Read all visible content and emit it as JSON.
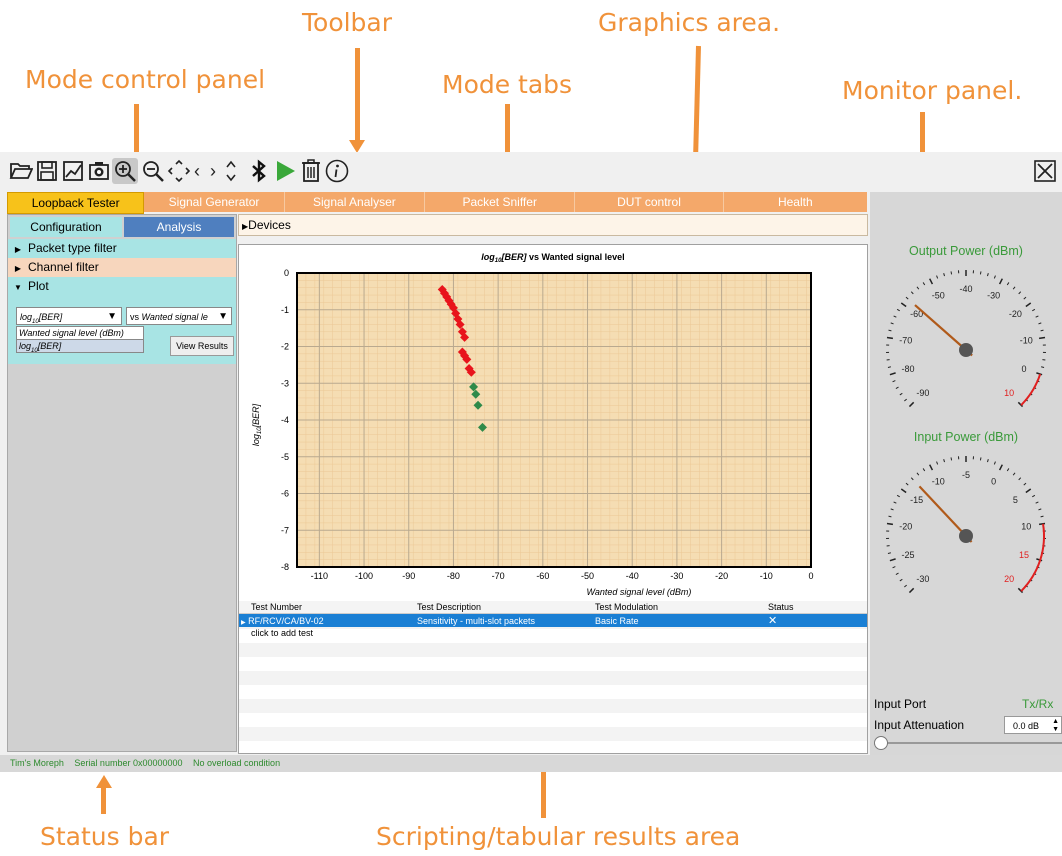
{
  "callouts": {
    "toolbar": "Toolbar",
    "graphics_area": "Graphics area.",
    "mode_control_panel": "Mode control panel",
    "mode_tabs": "Mode tabs",
    "monitor_panel": "Monitor panel.",
    "status_bar": "Status bar",
    "scripting_area": "Scripting/tabular results area"
  },
  "toolbar": {
    "icons": [
      "open-folder-icon",
      "save-icon",
      "chart-icon",
      "camera-icon",
      "zoom-in-icon",
      "zoom-out-icon",
      "pan-icon",
      "scroll-left-icon",
      "scroll-right-icon",
      "scroll-vertical-icon",
      "bluetooth-icon",
      "play-icon",
      "trash-icon",
      "info-icon",
      "close-window-icon"
    ]
  },
  "mode_tabs": [
    "Loopback Tester",
    "Signal Generator",
    "Signal Analyser",
    "Packet Sniffer",
    "DUT control",
    "Health"
  ],
  "active_mode_tab": "Loopback Tester",
  "control_panel": {
    "tabs": [
      "Configuration",
      "Analysis"
    ],
    "active_tab": "Analysis",
    "tree": [
      {
        "label": "Packet type filter",
        "expanded": false
      },
      {
        "label": "Channel filter",
        "expanded": false
      },
      {
        "label": "Plot",
        "expanded": true
      }
    ],
    "plot": {
      "y_select_label": "log",
      "y_select_sub": "10",
      "y_select_suffix": "[BER]",
      "x_select_prefix": "vs ",
      "x_select_value": "Wanted signal le",
      "dropdown_options": [
        "Wanted signal level (dBm)",
        "log10[BER]"
      ],
      "option_log": "log",
      "option_sub": "10",
      "option_suffix": "[BER]",
      "view_results_label": "View Results"
    }
  },
  "graphics": {
    "devices_label": "Devices",
    "results_table": {
      "columns": [
        "Test Number",
        "Test Description",
        "Test Modulation",
        "Status"
      ],
      "rows": [
        {
          "number": "RF/RCV/CA/BV-02",
          "description": "Sensitivity - multi-slot packets",
          "modulation": "Basic Rate",
          "status": "✕"
        }
      ],
      "add_row_label": "click to add test"
    }
  },
  "chart_data": {
    "type": "scatter",
    "title_prefix": "log",
    "title_sub": "10",
    "title_suffix": "[BER]",
    "title_rest": " vs Wanted signal level",
    "xlabel": "Wanted signal level (dBm)",
    "ylabel_prefix": "log",
    "ylabel_sub": "10",
    "ylabel_suffix": "[BER]",
    "xlim": [
      -115,
      0
    ],
    "ylim": [
      -8,
      0
    ],
    "x_ticks": [
      -110,
      -100,
      -90,
      -80,
      -70,
      -60,
      -50,
      -40,
      -30,
      -20,
      -10,
      0
    ],
    "y_ticks": [
      0,
      -1,
      -2,
      -3,
      -4,
      -5,
      -6,
      -7,
      -8
    ],
    "grid": true,
    "series": [
      {
        "color": "#e8141c",
        "points": [
          [
            -82.5,
            -0.45
          ],
          [
            -82,
            -0.55
          ],
          [
            -81.5,
            -0.65
          ],
          [
            -81,
            -0.75
          ],
          [
            -80.5,
            -0.85
          ],
          [
            -80,
            -0.95
          ],
          [
            -79.5,
            -1.1
          ],
          [
            -79,
            -1.25
          ],
          [
            -78.5,
            -1.4
          ],
          [
            -78,
            -1.6
          ],
          [
            -77.5,
            -1.75
          ],
          [
            -78,
            -2.15
          ],
          [
            -77.5,
            -2.25
          ],
          [
            -77,
            -2.35
          ],
          [
            -76.5,
            -2.6
          ],
          [
            -76,
            -2.7
          ]
        ]
      },
      {
        "color": "#2f8a4a",
        "points": [
          [
            -75.5,
            -3.1
          ],
          [
            -75,
            -3.3
          ],
          [
            -74.5,
            -3.6
          ],
          [
            -73.5,
            -4.2
          ]
        ]
      }
    ]
  },
  "monitor": {
    "output_gauge": {
      "title": "Output Power (dBm)",
      "min": -90,
      "max": 10,
      "labels": [
        -90,
        -80,
        -70,
        -60,
        -50,
        -40,
        -30,
        -20,
        -10,
        0,
        10
      ],
      "value": -58,
      "red_zone_from": 0
    },
    "input_gauge": {
      "title": "Input Power (dBm)",
      "min": -30,
      "max": 20,
      "labels": [
        -30,
        -25,
        -20,
        -15,
        -10,
        -5,
        0,
        5,
        10,
        15,
        20
      ],
      "value": -13,
      "red_zone_from": 10
    },
    "input_port_label": "Input Port",
    "input_port_value": "Tx/Rx",
    "input_attenuation_label": "Input Attenuation",
    "input_attenuation_value": "0.0 dB"
  },
  "status_bar": {
    "items": [
      "Tim's Moreph",
      "Serial number 0x00000000",
      "No overload condition"
    ]
  },
  "colors": {
    "callout": "#f0923a",
    "mode_tab": "#f4a86a",
    "mode_tab_active": "#f7c21a",
    "control_bg": "#a8e4e4",
    "control_alt": "#f7d6bd",
    "tab_active": "#4f7fbf",
    "plot_bg": "#f5ddb3",
    "selected_row": "#1a7fd4"
  }
}
